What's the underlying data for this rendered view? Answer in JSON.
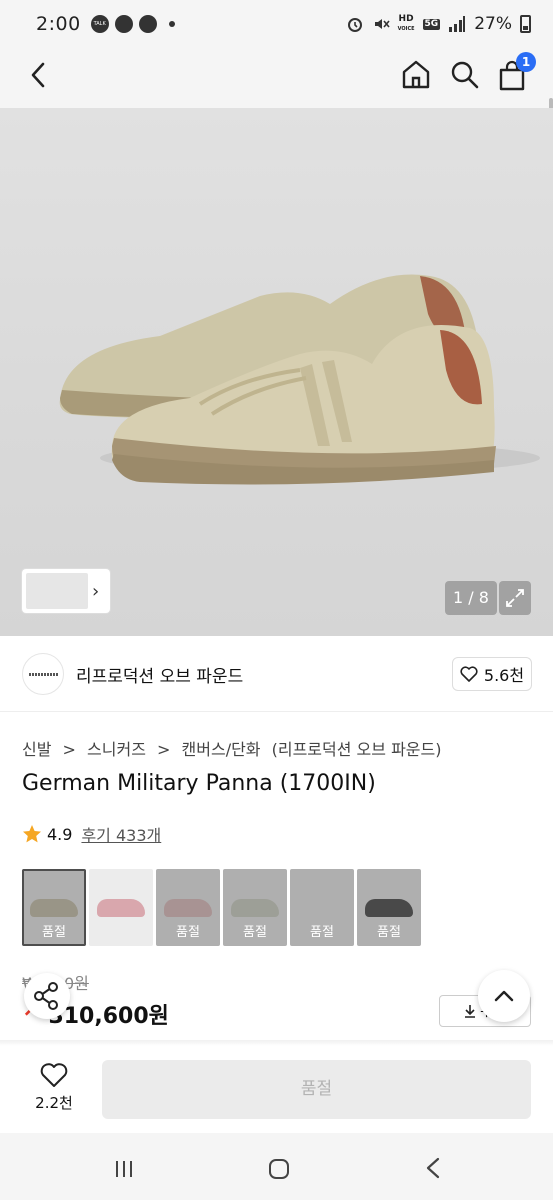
{
  "status_bar": {
    "time": "2:00",
    "talk_label": "TALK",
    "hd_label": "HD",
    "voice_label": "VOICE",
    "network_label": "5G",
    "battery": "27%"
  },
  "nav": {
    "cart_count": "1"
  },
  "gallery": {
    "counter": "1 / 8"
  },
  "brand": {
    "name": "리프로덕션 오브 파운드",
    "likes": "5.6천"
  },
  "breadcrumb": [
    "신발",
    ">",
    "스니커즈",
    ">",
    "캔버스/단화",
    "(리프로덕션 오브 파운드)"
  ],
  "product": {
    "title": "German Military Panna (1700IN)",
    "rating": "4.9",
    "reviews": "후기 433개"
  },
  "swatches": [
    {
      "label": "품절",
      "shoe_color": "#bcb59c",
      "selected": true
    },
    {
      "label": "",
      "shoe_color": "#d9a7ad",
      "selected": false
    },
    {
      "label": "품절",
      "shoe_color": "#d8b1b1",
      "selected": false
    },
    {
      "label": "품절",
      "shoe_color": "#c4c7b9",
      "selected": false
    },
    {
      "label": "품절",
      "shoe_color": "#e4e4e4",
      "selected": false
    },
    {
      "label": "품절",
      "shoe_color": "#2a2a2a",
      "selected": false
    }
  ],
  "price": {
    "original": "₩…00원",
    "discount": "↗",
    "sale": "310,600원",
    "coupon_label": "쿠폰"
  },
  "actions": {
    "wish_count": "2.2천",
    "buy_label": "품절"
  },
  "colors": {
    "accent_blue": "#2a6df5",
    "sale_red": "#ee3b2b",
    "star": "#f5a623"
  }
}
